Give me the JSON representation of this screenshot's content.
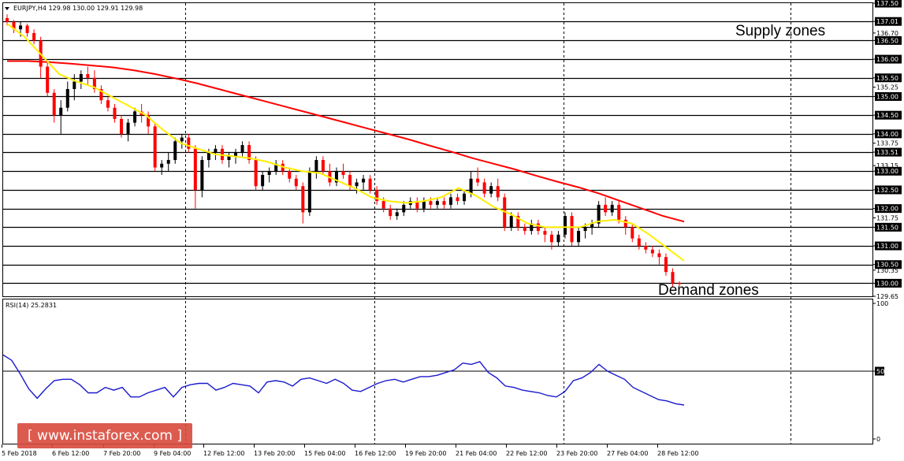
{
  "header": {
    "symbol_line": "EURJPY,H4  129.98 130.00 129.91 129.98"
  },
  "annotations": {
    "supply": "Supply zones",
    "demand": "Demand zones"
  },
  "rsi": {
    "label": "RSI(14) 25.2831",
    "levels": [
      100,
      50,
      0
    ],
    "level_line": 50
  },
  "watermark": "[ www.instaforex.com ]",
  "colors": {
    "bull": "#000000",
    "bear": "#ff0000",
    "ma_slow": "#ff0000",
    "ma_fast": "#ffee00",
    "rsi": "#1a1acc",
    "zone_line": "#000000",
    "grid": "#000000"
  },
  "chart_data": [
    {
      "type": "candlestick",
      "ylim": [
        129.65,
        137.5
      ],
      "price_labels": [
        "137.50",
        "137.01",
        "136.70",
        "136.50",
        "136.00",
        "135.50",
        "135.25",
        "135.00",
        "134.50",
        "134.00",
        "133.75",
        "133.51",
        "133.15",
        "133.00",
        "132.50",
        "132.00",
        "131.75",
        "131.50",
        "131.00",
        "130.50",
        "130.35",
        "130.00",
        "129.65"
      ],
      "zone_levels": [
        137.01,
        136.5,
        136.0,
        135.5,
        135.0,
        134.5,
        134.0,
        133.51,
        133.0,
        132.5,
        132.0,
        131.5,
        131.0,
        130.5,
        130.0
      ],
      "x_labels": [
        "5 Feb 2018",
        "6 Feb 12:00",
        "7 Feb 20:00",
        "9 Feb 04:00",
        "12 Feb 12:00",
        "13 Feb 20:00",
        "15 Feb 04:00",
        "16 Feb 12:00",
        "19 Feb 20:00",
        "21 Feb 04:00",
        "22 Feb 12:00",
        "23 Feb 20:00",
        "27 Feb 04:00",
        "28 Feb 12:00"
      ],
      "candles": [
        [
          137.1,
          137.2,
          136.9,
          137.0
        ],
        [
          137.0,
          137.05,
          136.7,
          136.8
        ],
        [
          136.8,
          137.0,
          136.6,
          136.9
        ],
        [
          136.9,
          136.95,
          136.6,
          136.7
        ],
        [
          136.7,
          136.8,
          136.4,
          136.5
        ],
        [
          136.5,
          136.6,
          135.5,
          135.8
        ],
        [
          135.8,
          135.9,
          135.0,
          135.1
        ],
        [
          135.1,
          135.2,
          134.3,
          134.5
        ],
        [
          134.5,
          134.9,
          134.0,
          134.7
        ],
        [
          134.7,
          135.4,
          134.6,
          135.2
        ],
        [
          135.2,
          135.6,
          134.9,
          135.4
        ],
        [
          135.4,
          135.7,
          135.2,
          135.6
        ],
        [
          135.6,
          135.8,
          135.3,
          135.5
        ],
        [
          135.5,
          135.7,
          135.1,
          135.2
        ],
        [
          135.2,
          135.3,
          134.8,
          134.9
        ],
        [
          134.9,
          135.0,
          134.6,
          134.7
        ],
        [
          134.7,
          134.8,
          134.3,
          134.4
        ],
        [
          134.4,
          134.5,
          133.9,
          134.0
        ],
        [
          134.0,
          134.4,
          133.8,
          134.3
        ],
        [
          134.3,
          134.7,
          134.2,
          134.6
        ],
        [
          134.6,
          134.8,
          134.3,
          134.5
        ],
        [
          134.5,
          134.6,
          134.0,
          134.2
        ],
        [
          134.2,
          134.3,
          133.0,
          133.1
        ],
        [
          133.1,
          133.3,
          132.9,
          133.2
        ],
        [
          133.2,
          133.5,
          133.0,
          133.3
        ],
        [
          133.3,
          133.9,
          133.2,
          133.8
        ],
        [
          133.8,
          134.0,
          133.6,
          133.9
        ],
        [
          133.9,
          134.0,
          133.5,
          133.6
        ],
        [
          133.6,
          133.7,
          132.0,
          132.5
        ],
        [
          132.5,
          133.4,
          132.3,
          133.3
        ],
        [
          133.3,
          133.6,
          133.1,
          133.5
        ],
        [
          133.5,
          133.7,
          133.3,
          133.6
        ],
        [
          133.6,
          133.7,
          133.2,
          133.3
        ],
        [
          133.3,
          133.5,
          133.1,
          133.4
        ],
        [
          133.4,
          133.6,
          133.2,
          133.5
        ],
        [
          133.5,
          133.8,
          133.4,
          133.7
        ],
        [
          133.7,
          133.8,
          133.2,
          133.3
        ],
        [
          133.3,
          133.4,
          132.5,
          132.6
        ],
        [
          132.6,
          133.0,
          132.5,
          132.9
        ],
        [
          132.9,
          133.1,
          132.7,
          133.0
        ],
        [
          133.0,
          133.3,
          132.9,
          133.2
        ],
        [
          133.2,
          133.3,
          132.9,
          133.0
        ],
        [
          133.0,
          133.1,
          132.7,
          132.8
        ],
        [
          132.8,
          132.9,
          132.5,
          132.6
        ],
        [
          132.6,
          132.7,
          131.6,
          131.9
        ],
        [
          131.9,
          133.1,
          131.8,
          133.0
        ],
        [
          133.0,
          133.4,
          132.8,
          133.3
        ],
        [
          133.3,
          133.4,
          132.9,
          133.0
        ],
        [
          133.0,
          133.2,
          132.6,
          132.7
        ],
        [
          132.7,
          133.1,
          132.6,
          133.0
        ],
        [
          133.0,
          133.2,
          132.8,
          132.9
        ],
        [
          132.9,
          133.0,
          132.5,
          132.6
        ],
        [
          132.6,
          132.8,
          132.4,
          132.7
        ],
        [
          132.7,
          132.9,
          132.5,
          132.8
        ],
        [
          132.8,
          132.9,
          132.4,
          132.5
        ],
        [
          132.5,
          132.6,
          132.1,
          132.2
        ],
        [
          132.2,
          132.3,
          131.9,
          132.0
        ],
        [
          132.0,
          132.1,
          131.7,
          131.8
        ],
        [
          131.8,
          132.0,
          131.7,
          131.9
        ],
        [
          131.9,
          132.2,
          131.8,
          132.1
        ],
        [
          132.1,
          132.3,
          132.0,
          132.2
        ],
        [
          132.2,
          132.3,
          131.9,
          132.0
        ],
        [
          132.0,
          132.3,
          131.9,
          132.2
        ],
        [
          132.2,
          132.3,
          132.0,
          132.1
        ],
        [
          132.1,
          132.3,
          132.0,
          132.2
        ],
        [
          132.2,
          132.3,
          132.0,
          132.1
        ],
        [
          132.1,
          132.4,
          132.0,
          132.3
        ],
        [
          132.3,
          132.4,
          132.1,
          132.2
        ],
        [
          132.2,
          132.5,
          132.1,
          132.4
        ],
        [
          132.4,
          133.0,
          132.3,
          132.8
        ],
        [
          132.8,
          133.1,
          132.6,
          132.7
        ],
        [
          132.7,
          132.8,
          132.3,
          132.4
        ],
        [
          132.4,
          132.7,
          132.3,
          132.6
        ],
        [
          132.6,
          132.8,
          132.2,
          132.3
        ],
        [
          132.3,
          132.4,
          131.4,
          131.5
        ],
        [
          131.5,
          131.9,
          131.4,
          131.8
        ],
        [
          131.8,
          131.9,
          131.4,
          131.5
        ],
        [
          131.5,
          131.6,
          131.3,
          131.4
        ],
        [
          131.4,
          131.7,
          131.3,
          131.6
        ],
        [
          131.6,
          131.7,
          131.3,
          131.4
        ],
        [
          131.4,
          131.5,
          131.1,
          131.3
        ],
        [
          131.3,
          131.4,
          130.9,
          131.1
        ],
        [
          131.1,
          131.4,
          131.0,
          131.3
        ],
        [
          131.3,
          131.9,
          131.2,
          131.8
        ],
        [
          131.8,
          131.9,
          131.0,
          131.1
        ],
        [
          131.1,
          131.5,
          131.0,
          131.4
        ],
        [
          131.4,
          131.6,
          131.2,
          131.5
        ],
        [
          131.5,
          131.7,
          131.3,
          131.6
        ],
        [
          131.6,
          132.2,
          131.5,
          132.1
        ],
        [
          132.1,
          132.3,
          131.8,
          131.9
        ],
        [
          131.9,
          132.2,
          131.8,
          132.1
        ],
        [
          132.1,
          132.2,
          131.6,
          131.7
        ],
        [
          131.7,
          131.8,
          131.3,
          131.5
        ],
        [
          131.5,
          131.6,
          131.1,
          131.2
        ],
        [
          131.2,
          131.3,
          130.9,
          131.0
        ],
        [
          131.0,
          131.1,
          130.8,
          130.9
        ],
        [
          130.9,
          131.0,
          130.7,
          130.8
        ],
        [
          130.8,
          130.9,
          130.5,
          130.7
        ],
        [
          130.7,
          130.8,
          130.2,
          130.3
        ],
        [
          130.3,
          130.4,
          129.91,
          130.0
        ],
        [
          130.0,
          130.05,
          129.91,
          129.98
        ]
      ],
      "ma_slow": [
        135.95,
        135.95,
        135.92,
        135.88,
        135.83,
        135.78,
        135.7,
        135.6,
        135.48,
        135.35,
        135.2,
        135.05,
        134.9,
        134.75,
        134.6,
        134.45,
        134.3,
        134.15,
        134.0,
        133.85,
        133.68,
        133.52,
        133.35,
        133.2,
        133.05,
        132.88,
        132.72,
        132.57,
        132.4,
        132.2,
        132.0,
        131.8,
        131.65
      ],
      "ma_fast": [
        136.95,
        136.6,
        136.1,
        135.6,
        135.4,
        135.25,
        135.0,
        134.75,
        134.5,
        134.1,
        133.75,
        133.6,
        133.45,
        133.4,
        133.35,
        133.25,
        133.1,
        133.0,
        132.95,
        132.75,
        132.55,
        132.3,
        132.2,
        132.15,
        132.2,
        132.3,
        132.55,
        132.35,
        132.05,
        131.85,
        131.6,
        131.5,
        131.5,
        131.5,
        131.65,
        131.7,
        131.6,
        131.3,
        130.95,
        130.6
      ]
    },
    {
      "type": "line",
      "ylim": [
        0,
        100
      ],
      "series": [
        {
          "name": "RSI(14)",
          "values": [
            62,
            58,
            48,
            37,
            30,
            37,
            43,
            44,
            44,
            40,
            34,
            34,
            38,
            36,
            38,
            31,
            31,
            34,
            36,
            38,
            31,
            38,
            40,
            41,
            41,
            36,
            38,
            41,
            40,
            39,
            34,
            42,
            43,
            42,
            39,
            44,
            45,
            43,
            41,
            44,
            41,
            36,
            35,
            38,
            41,
            43,
            44,
            42,
            44,
            46,
            46,
            47,
            49,
            51,
            56,
            55,
            57,
            49,
            45,
            39,
            38,
            36,
            35,
            34,
            32,
            31,
            35,
            43,
            45,
            49,
            55,
            50,
            47,
            44,
            38,
            35,
            32,
            29,
            28,
            26,
            25
          ]
        }
      ]
    }
  ]
}
